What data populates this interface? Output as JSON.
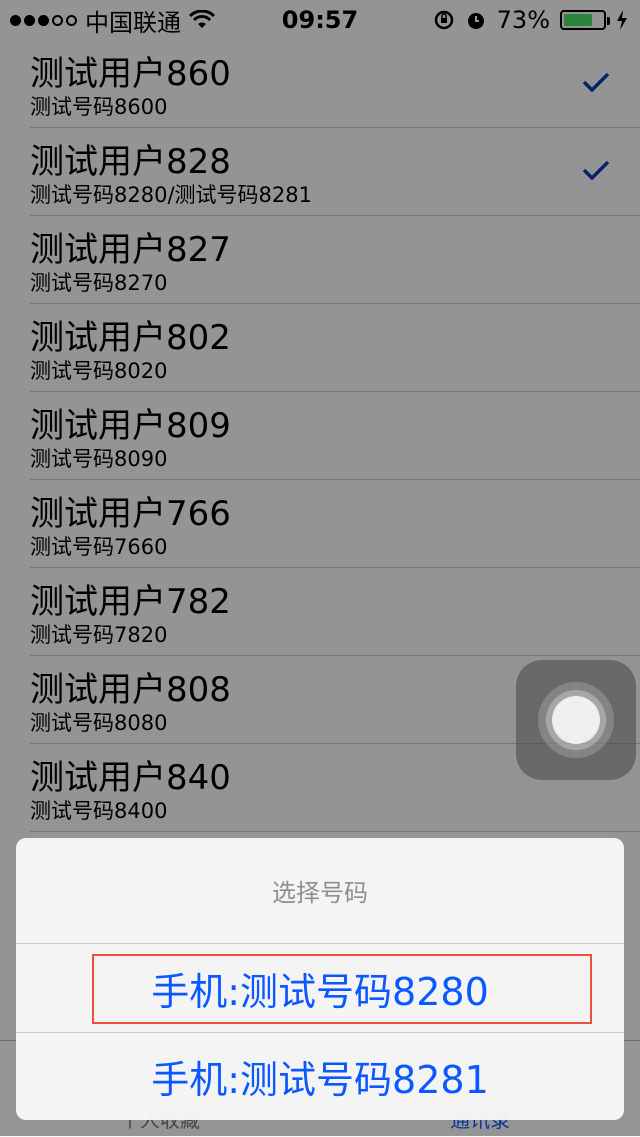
{
  "status_bar": {
    "carrier": "中国联通",
    "time": "09:57",
    "battery_percent": "73%",
    "battery_level": 0.73,
    "signal_bars_filled": 3,
    "signal_bars_total": 5
  },
  "contacts": [
    {
      "name": "测试用户860",
      "phone": "测试号码8600",
      "checked": true
    },
    {
      "name": "测试用户828",
      "phone": "测试号码8280/测试号码8281",
      "checked": true
    },
    {
      "name": "测试用户827",
      "phone": "测试号码8270",
      "checked": false
    },
    {
      "name": "测试用户802",
      "phone": "测试号码8020",
      "checked": false
    },
    {
      "name": "测试用户809",
      "phone": "测试号码8090",
      "checked": false
    },
    {
      "name": "测试用户766",
      "phone": "测试号码7660",
      "checked": false
    },
    {
      "name": "测试用户782",
      "phone": "测试号码7820",
      "checked": false
    },
    {
      "name": "测试用户808",
      "phone": "测试号码8080",
      "checked": false
    },
    {
      "name": "测试用户840",
      "phone": "测试号码8400",
      "checked": false
    }
  ],
  "tabbar": {
    "left_label": "个人收藏",
    "right_label": "通讯录"
  },
  "action_sheet": {
    "title": "选择号码",
    "options": [
      {
        "label": "手机:测试号码8280"
      },
      {
        "label": "手机:测试号码8281"
      }
    ]
  },
  "colors": {
    "accent": "#0a58ff",
    "check": "#0a3fa8",
    "highlight_border": "#e8523f",
    "battery": "#4cd964"
  },
  "icons": {
    "wifi": "wifi-icon",
    "rotation_lock": "rotation-lock-icon",
    "alarm": "alarm-icon",
    "charging": "charging-bolt-icon",
    "check": "checkmark-icon"
  }
}
